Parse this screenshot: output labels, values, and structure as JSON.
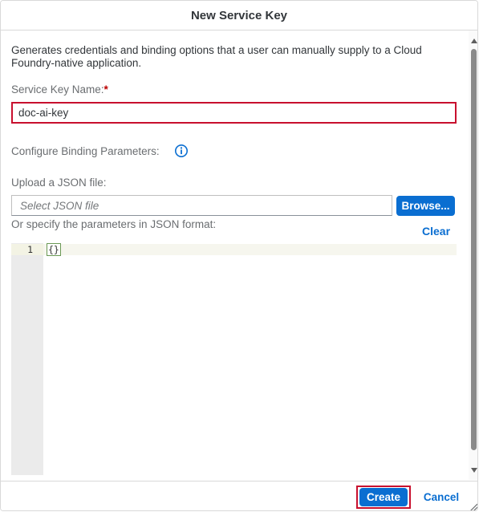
{
  "dialog": {
    "title": "New Service Key",
    "description": "Generates credentials and binding options that a user can manually supply to a Cloud Foundry-native application.",
    "service_key_name": {
      "label": "Service Key Name:",
      "required_marker": "*",
      "value": "doc-ai-key"
    },
    "binding_parameters_label": "Configure Binding Parameters:",
    "upload": {
      "label": "Upload a JSON file:",
      "placeholder": "Select JSON file",
      "browse_label": "Browse..."
    },
    "json_section": {
      "label": "Or specify the parameters in JSON format:",
      "clear_label": "Clear",
      "line_number": "1",
      "code": "{}"
    },
    "footer": {
      "create_label": "Create",
      "cancel_label": "Cancel"
    }
  },
  "colors": {
    "accent": "#0a6ed1",
    "highlight_outline": "#c8102e",
    "required": "#bb0000"
  },
  "icons": {
    "info": "info-icon",
    "resize": "resize-grip-icon"
  }
}
